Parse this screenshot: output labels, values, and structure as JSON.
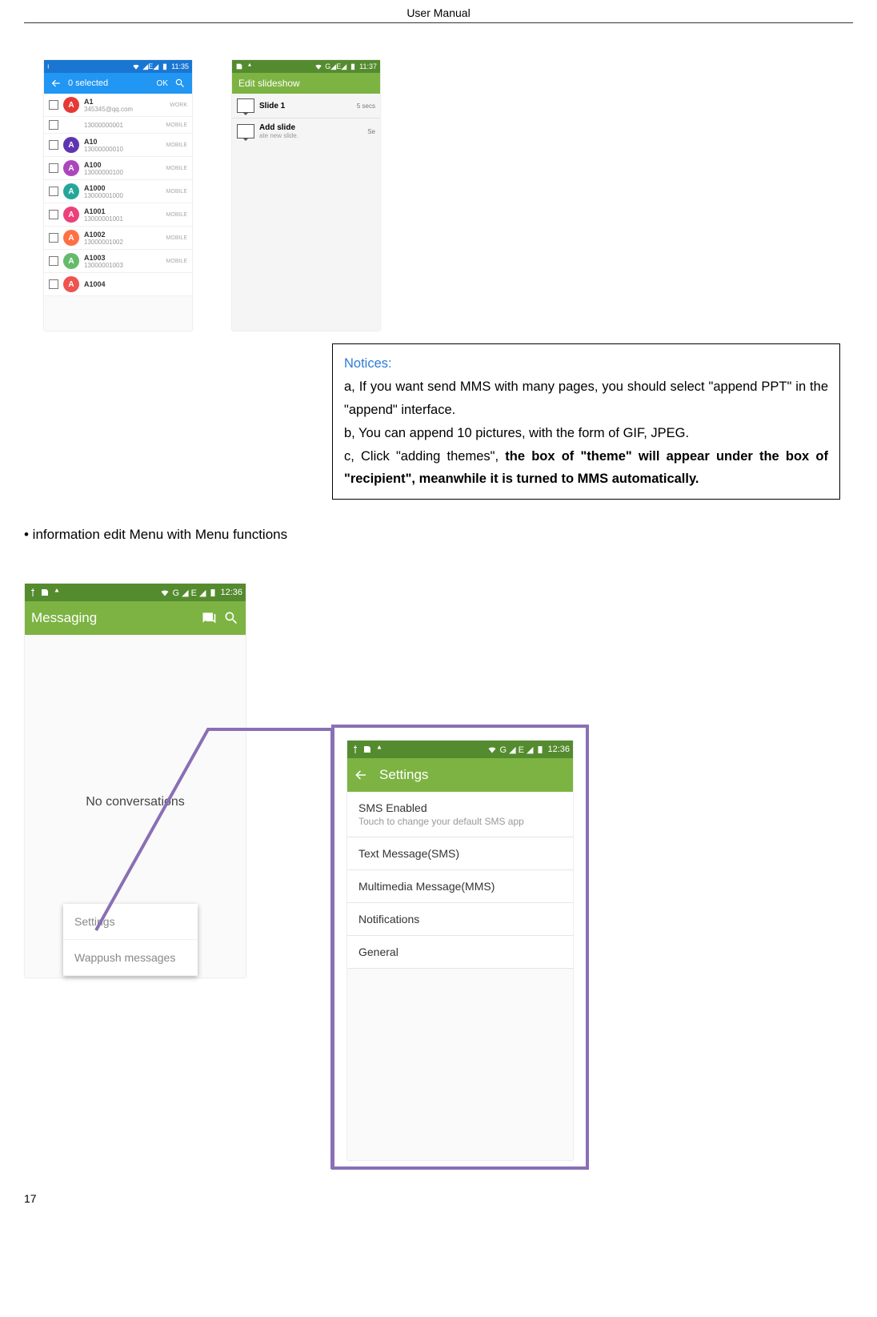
{
  "header": "User    Manual",
  "page_number": "17",
  "phone_a": {
    "time": "11:35",
    "selected_label": "0 selected",
    "ok_label": "OK",
    "contacts": [
      {
        "avatar": "A",
        "color": "#e53935",
        "line1": "A1",
        "line2": "345345@qq.com",
        "type": "WORK"
      },
      {
        "avatar": "",
        "color": "",
        "line1": "",
        "line2": "13000000001",
        "type": "MOBILE"
      },
      {
        "avatar": "A",
        "color": "#5e35b1",
        "line1": "A10",
        "line2": "13000000010",
        "type": "MOBILE"
      },
      {
        "avatar": "A",
        "color": "#ab47bc",
        "line1": "A100",
        "line2": "13000000100",
        "type": "MOBILE"
      },
      {
        "avatar": "A",
        "color": "#26a69a",
        "line1": "A1000",
        "line2": "13000001000",
        "type": "MOBILE"
      },
      {
        "avatar": "A",
        "color": "#ec407a",
        "line1": "A1001",
        "line2": "13000001001",
        "type": "MOBILE"
      },
      {
        "avatar": "A",
        "color": "#ff7043",
        "line1": "A1002",
        "line2": "13000001002",
        "type": "MOBILE"
      },
      {
        "avatar": "A",
        "color": "#66bb6a",
        "line1": "A1003",
        "line2": "13000001003",
        "type": "MOBILE"
      },
      {
        "avatar": "A",
        "color": "#ef5350",
        "line1": "A1004",
        "line2": "",
        "type": ""
      }
    ]
  },
  "phone_b": {
    "time": "11:37",
    "title": "Edit slideshow",
    "slide_label": "Slide 1",
    "slide_secs": "5 secs",
    "add_label": "Add slide",
    "add_sub_left": "ate new slide.",
    "add_sub_right": "Se"
  },
  "notices": {
    "title": "Notices:",
    "a": "a, If you want send MMS with many pages, you should select \"append PPT\" in the \"append\" interface.",
    "b": "b, You can append 10 pictures, with the form of GIF, JPEG.",
    "c_prefix": "c, Click \"adding themes\", ",
    "c_bold": "the box of \"theme\" will appear under the box of \"recipient\", meanwhile it is turned to MMS automatically."
  },
  "bullet_text": "• information edit Menu with Menu functions",
  "phone_c": {
    "time": "12:36",
    "title": "Messaging",
    "no_conv": "No conversations",
    "menu": {
      "settings": "Settings",
      "wappush": "Wappush messages"
    }
  },
  "phone_d": {
    "time": "12:36",
    "title": "Settings",
    "items": [
      {
        "title": "SMS Enabled",
        "sub": "Touch to change your default SMS app"
      },
      {
        "title": "Text Message(SMS)",
        "sub": ""
      },
      {
        "title": "Multimedia Message(MMS)",
        "sub": ""
      },
      {
        "title": "Notifications",
        "sub": ""
      },
      {
        "title": "General",
        "sub": ""
      }
    ]
  },
  "status_signal": "G ◢ E ◢"
}
